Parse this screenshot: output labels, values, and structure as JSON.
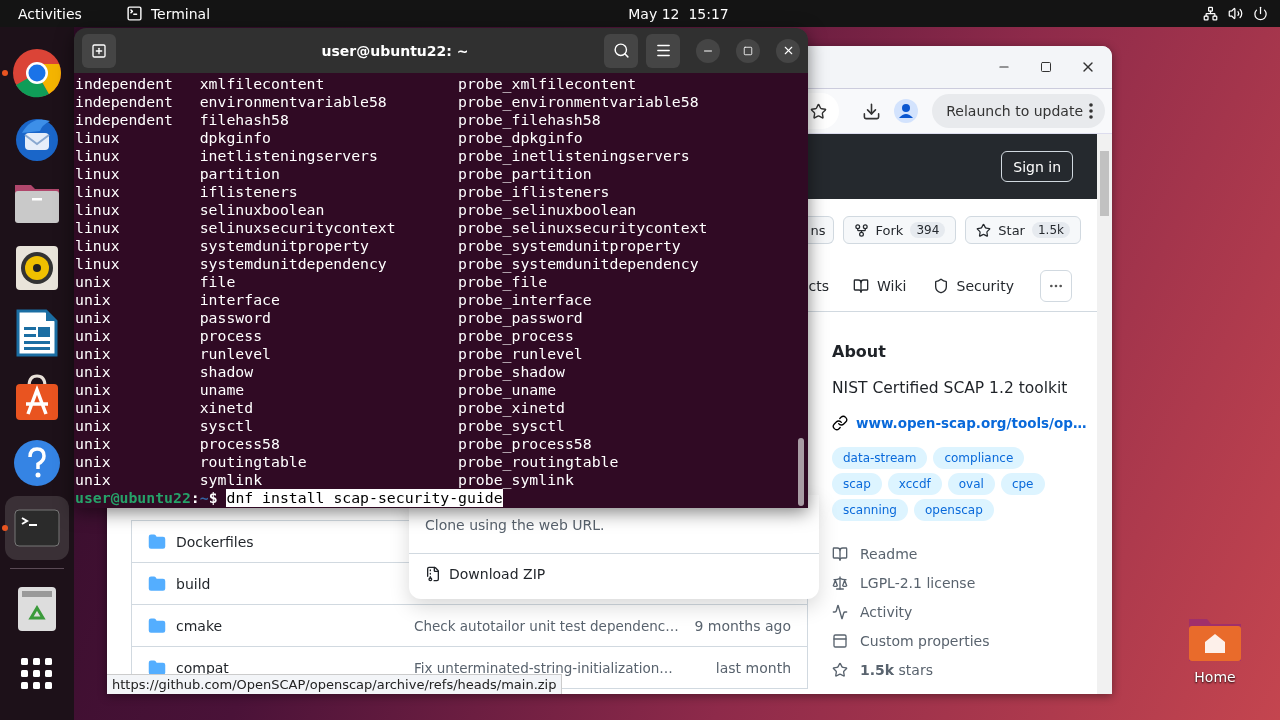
{
  "top_bar": {
    "activities": "Activities",
    "app": "Terminal",
    "clock": "May 12  15:17"
  },
  "dock": [
    {
      "kind": "chrome",
      "running": true,
      "selected": false
    },
    {
      "kind": "mail",
      "running": false,
      "selected": false
    },
    {
      "kind": "files",
      "running": false,
      "selected": false
    },
    {
      "kind": "music",
      "running": false,
      "selected": false
    },
    {
      "kind": "writer",
      "running": false,
      "selected": false
    },
    {
      "kind": "store",
      "running": false,
      "selected": false
    },
    {
      "kind": "help",
      "running": false,
      "selected": false
    },
    {
      "kind": "terminal",
      "running": true,
      "selected": true
    },
    {
      "kind": "trash",
      "running": false,
      "selected": false
    },
    {
      "kind": "apps",
      "running": false,
      "selected": false
    }
  ],
  "terminal": {
    "title": "user@ubuntu22: ~",
    "lines": [
      [
        "independent",
        "xmlfilecontent",
        "probe_xmlfilecontent"
      ],
      [
        "independent",
        "environmentvariable58",
        "probe_environmentvariable58"
      ],
      [
        "independent",
        "filehash58",
        "probe_filehash58"
      ],
      [
        "linux",
        "dpkginfo",
        "probe_dpkginfo"
      ],
      [
        "linux",
        "inetlisteningservers",
        "probe_inetlisteningservers"
      ],
      [
        "linux",
        "partition",
        "probe_partition"
      ],
      [
        "linux",
        "iflisteners",
        "probe_iflisteners"
      ],
      [
        "linux",
        "selinuxboolean",
        "probe_selinuxboolean"
      ],
      [
        "linux",
        "selinuxsecuritycontext",
        "probe_selinuxsecuritycontext"
      ],
      [
        "linux",
        "systemdunitproperty",
        "probe_systemdunitproperty"
      ],
      [
        "linux",
        "systemdunitdependency",
        "probe_systemdunitdependency"
      ],
      [
        "unix",
        "file",
        "probe_file"
      ],
      [
        "unix",
        "interface",
        "probe_interface"
      ],
      [
        "unix",
        "password",
        "probe_password"
      ],
      [
        "unix",
        "process",
        "probe_process"
      ],
      [
        "unix",
        "runlevel",
        "probe_runlevel"
      ],
      [
        "unix",
        "shadow",
        "probe_shadow"
      ],
      [
        "unix",
        "uname",
        "probe_uname"
      ],
      [
        "unix",
        "xinetd",
        "probe_xinetd"
      ],
      [
        "unix",
        "sysctl",
        "probe_sysctl"
      ],
      [
        "unix",
        "process58",
        "probe_process58"
      ],
      [
        "unix",
        "routingtable",
        "probe_routingtable"
      ],
      [
        "unix",
        "symlink",
        "probe_symlink"
      ]
    ],
    "prompt": {
      "user_host": "user@ubuntu22",
      "separator": ":",
      "path": "~",
      "symbol": "$",
      "command": "dnf install scap-security-guide",
      "command_selected": true
    }
  },
  "browser": {
    "relaunch": "Relaunch to update",
    "sign_in": "Sign in",
    "actions": [
      {
        "kind": "partial",
        "label": "ns"
      },
      {
        "kind": "fork",
        "label": "Fork",
        "count": "394"
      },
      {
        "kind": "star",
        "label": "Star",
        "count": "1.5k"
      }
    ],
    "tabs": [
      {
        "kind": "partial",
        "label": "cts"
      },
      {
        "kind": "wiki",
        "label": "Wiki"
      },
      {
        "kind": "security",
        "label": "Security"
      },
      {
        "kind": "more"
      }
    ],
    "files": [
      {
        "name": "Dockerfiles"
      },
      {
        "name": "build"
      },
      {
        "name": "cmake",
        "message": "Check autotailor unit test dependenc…",
        "date": "9 months ago"
      },
      {
        "name": "compat",
        "message": "Fix unterminated-string-initialization…",
        "date": "last month"
      }
    ],
    "clone_menu": {
      "hint": "Clone using the web URL.",
      "download": "Download ZIP"
    },
    "about": {
      "title": "About",
      "description": "NIST Certified SCAP 1.2 toolkit",
      "link": "www.open-scap.org/tools/op…",
      "topics": [
        "data-stream",
        "compliance",
        "scap",
        "xccdf",
        "oval",
        "cpe",
        "scanning",
        "openscap"
      ],
      "meta": [
        {
          "kind": "readme",
          "label": "Readme"
        },
        {
          "kind": "license",
          "label": "LGPL-2.1 license"
        },
        {
          "kind": "activity",
          "label": "Activity"
        },
        {
          "kind": "properties",
          "label": "Custom properties"
        },
        {
          "kind": "stars",
          "label": "**1.5k** stars"
        }
      ]
    },
    "status_url": "https://github.com/OpenSCAP/openscap/archive/refs/heads/main.zip"
  },
  "desktop_icons": [
    {
      "label": "Home"
    }
  ]
}
